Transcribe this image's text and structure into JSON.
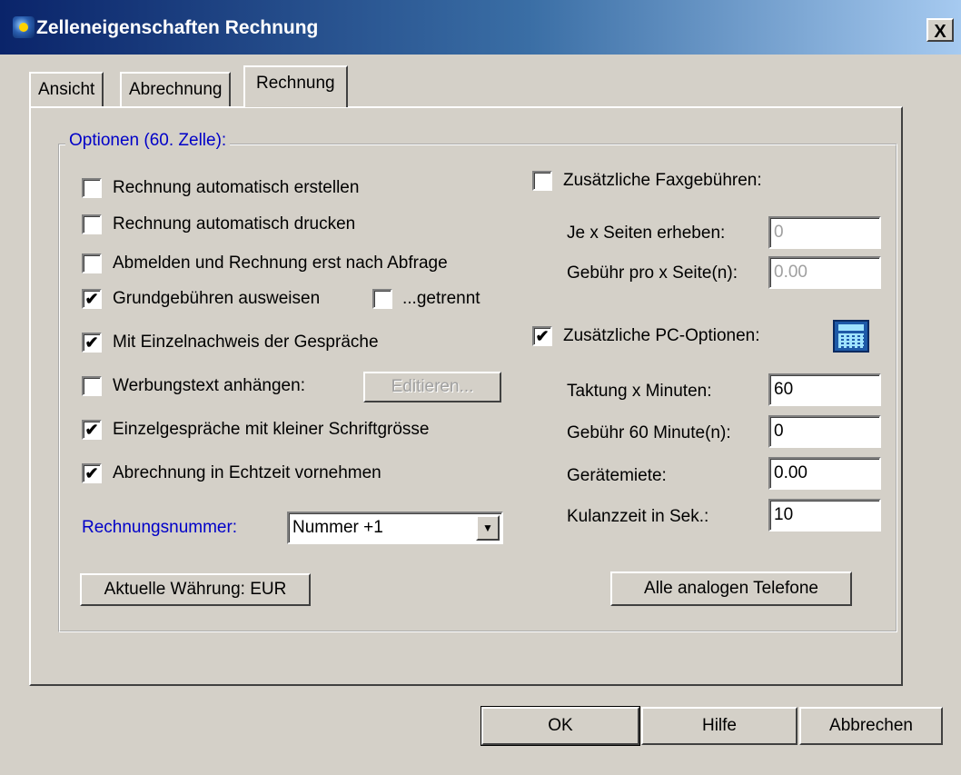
{
  "window": {
    "title": "Zelleneigenschaften Rechnung",
    "close_label": "X"
  },
  "tabs": [
    {
      "label": "Ansicht"
    },
    {
      "label": "Abrechnung"
    },
    {
      "label": "Rechnung"
    }
  ],
  "group": {
    "legend": "Optionen (60. Zelle):"
  },
  "left_options": {
    "auto_create": {
      "label": "Rechnung automatisch erstellen",
      "checked": ""
    },
    "auto_print": {
      "label": "Rechnung automatisch drucken",
      "checked": ""
    },
    "logout_query": {
      "label": "Abmelden und Rechnung erst nach Abfrage",
      "checked": ""
    },
    "basic_fees": {
      "label": "Grundgebühren ausweisen",
      "checked": "✔"
    },
    "separate": {
      "label": "...getrennt",
      "checked": ""
    },
    "itemized": {
      "label": "Mit Einzelnachweis der Gespräche",
      "checked": "✔"
    },
    "advert": {
      "label": "Werbungstext anhängen:",
      "checked": ""
    },
    "edit_button": "Editieren...",
    "small_font": {
      "label": "Einzelgespräche mit kleiner Schriftgrösse",
      "checked": "✔"
    },
    "realtime": {
      "label": "Abrechnung in Echtzeit vornehmen",
      "checked": "✔"
    },
    "invoice_number_label": "Rechnungsnummer:",
    "invoice_number_value": "Nummer +1",
    "currency_button": "Aktuelle Währung: EUR"
  },
  "right_options": {
    "fax": {
      "label": "Zusätzliche Faxgebühren:",
      "checked": ""
    },
    "pages_label": "Je x Seiten erheben:",
    "pages_value": "0",
    "fee_page_label": "Gebühr pro x Seite(n):",
    "fee_page_value": "0.00",
    "pc": {
      "label": "Zusätzliche PC-Optionen:",
      "checked": "✔"
    },
    "cycle_label": "Taktung x Minuten:",
    "cycle_value": "60",
    "fee_min_label": "Gebühr 60 Minute(n):",
    "fee_min_value": "0",
    "rent_label": "Gerätemiete:",
    "rent_value": "0.00",
    "grace_label": "Kulanzzeit in Sek.:",
    "grace_value": "10",
    "phones_button": "Alle analogen Telefone"
  },
  "footer": {
    "ok": "OK",
    "help": "Hilfe",
    "cancel": "Abbrechen"
  }
}
